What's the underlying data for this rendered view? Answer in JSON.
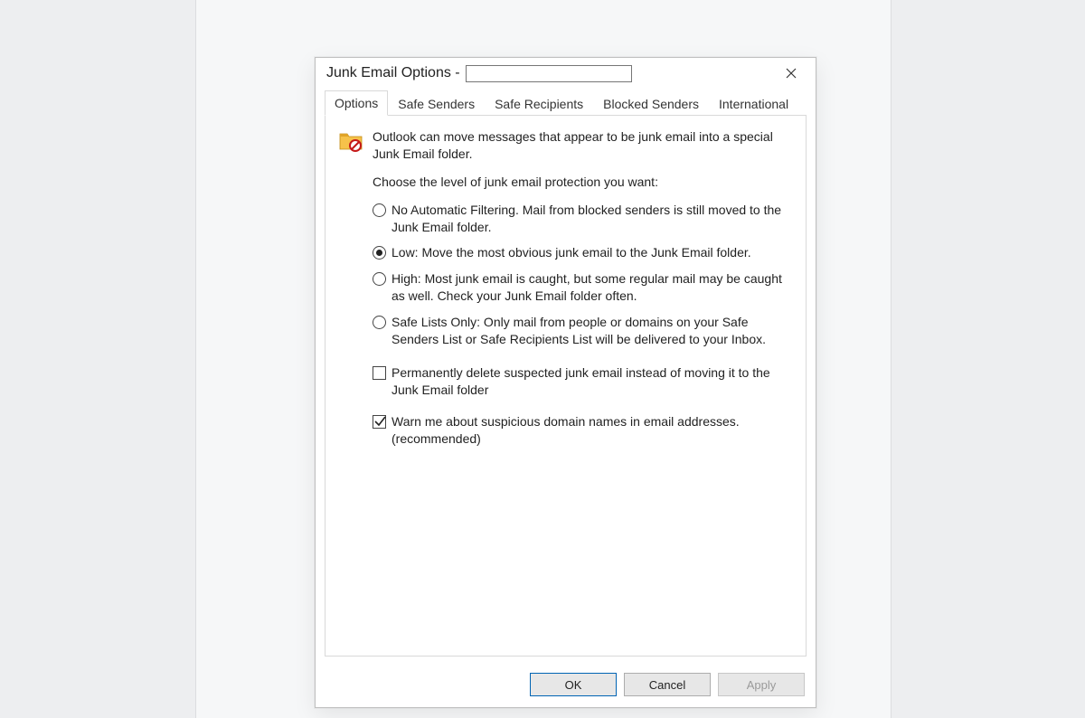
{
  "titlebar": {
    "title": "Junk Email Options -",
    "input_value": ""
  },
  "tabs": [
    {
      "label": "Options",
      "active": true
    },
    {
      "label": "Safe Senders",
      "active": false
    },
    {
      "label": "Safe Recipients",
      "active": false
    },
    {
      "label": "Blocked Senders",
      "active": false
    },
    {
      "label": "International",
      "active": false
    }
  ],
  "body": {
    "intro": "Outlook can move messages that appear to be junk email into a special Junk Email folder.",
    "choose_label": "Choose the level of junk email protection you want:",
    "radios": [
      {
        "label": "No Automatic Filtering. Mail from blocked senders is still moved to the Junk Email folder.",
        "selected": false
      },
      {
        "label": "Low: Move the most obvious junk email to the Junk Email folder.",
        "selected": true
      },
      {
        "label": "High: Most junk email is caught, but some regular mail may be caught as well. Check your Junk Email folder often.",
        "selected": false
      },
      {
        "label": "Safe Lists Only: Only mail from people or domains on your Safe Senders List or Safe Recipients List will be delivered to your Inbox.",
        "selected": false
      }
    ],
    "checkboxes": [
      {
        "label": "Permanently delete suspected junk email instead of moving it to the Junk Email folder",
        "checked": false
      },
      {
        "label": "Warn me about suspicious domain names in email addresses. (recommended)",
        "checked": true
      }
    ]
  },
  "buttons": {
    "ok": "OK",
    "cancel": "Cancel",
    "apply": "Apply"
  }
}
